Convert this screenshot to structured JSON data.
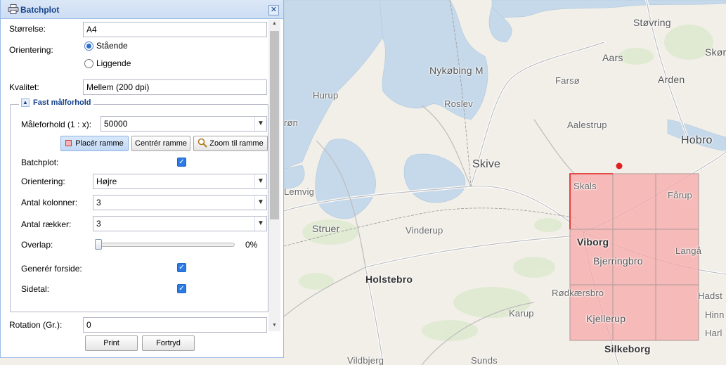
{
  "panel": {
    "title": "Batchplot",
    "close_symbol": "✕",
    "size_label": "Størrelse:",
    "size_value": "A4",
    "orientation_label": "Orientering:",
    "orientation_options": [
      "Stående",
      "Liggende"
    ],
    "orientation_selected": "Stående",
    "quality_label": "Kvalitet:",
    "quality_value": "Mellem (200 dpi)",
    "fieldset": {
      "legend": "Fast målforhold",
      "toggle_symbol": "▲",
      "scale_label": "Måleforhold (1 : x):",
      "scale_value": "50000",
      "buttons": [
        "Placér ramme",
        "Centrér ramme",
        "Zoom til ramme"
      ],
      "batchplot_label": "Batchplot:",
      "batchplot_checked": true,
      "orientation_label": "Orientering:",
      "orientation_value": "Højre",
      "columns_label": "Antal kolonner:",
      "columns_value": "3",
      "rows_label": "Antal rækker:",
      "rows_value": "3",
      "overlap_label": "Overlap:",
      "overlap_value": "0%",
      "overlap_fraction": 0,
      "cover_label": "Generér forside:",
      "cover_checked": true,
      "pagenum_label": "Sidetal:",
      "pagenum_checked": true
    },
    "rotation_label": "Rotation (Gr.):",
    "rotation_value": "0",
    "print_label": "Print",
    "cancel_label": "Fortryd",
    "dropdown_arrow": "▼",
    "check_symbol": "✓"
  },
  "map": {
    "places": [
      "Støvring",
      "Skør",
      "Aars",
      "Farsø",
      "Arden",
      "Nykøbing M",
      "Hurup",
      "Roslev",
      "Aalestrup",
      "Hobro",
      "Skive",
      "Skals",
      "Fårup",
      "Lemvig",
      "Struer",
      "Vinderup",
      "Viborg",
      "Bjerringbro",
      "Langå",
      "Holstebro",
      "Rødkærsbro",
      "Hadst",
      "Karup",
      "Kjellerup",
      "Hinn",
      "Harl",
      "Silkeborg",
      "Vildbjerg",
      "Sunds",
      "røn"
    ],
    "grid": {
      "columns": 3,
      "rows": 3,
      "fill_color": "#f7a8a8",
      "border_color": "#e02020"
    },
    "water_color": "#c5d9ea",
    "marker_color": "#e02020"
  }
}
